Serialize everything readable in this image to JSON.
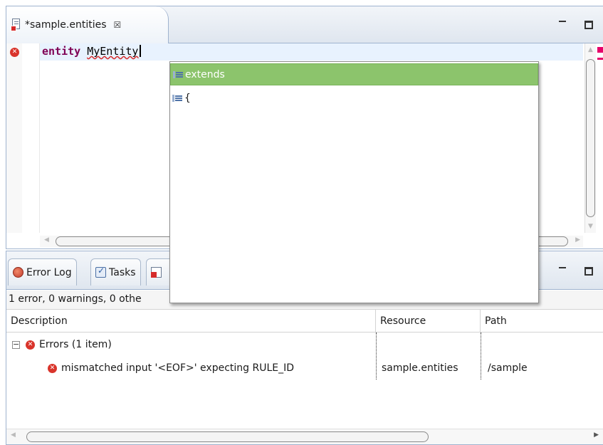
{
  "editor": {
    "tab_title": "*sample.entities",
    "tab_close_glyph": "☒",
    "code": {
      "keyword": "entity",
      "identifier": "MyEntity"
    },
    "error_marker_glyph": "✕"
  },
  "content_assist": {
    "items": [
      {
        "label": "extends",
        "selected": true
      },
      {
        "label": "{",
        "selected": false
      }
    ]
  },
  "bottom_view": {
    "tabs": [
      {
        "label": "Error Log"
      },
      {
        "label": "Tasks"
      },
      {
        "label": ""
      }
    ],
    "summary": "1 error, 0 warnings, 0 othe",
    "columns": [
      "Description",
      "Resource",
      "Path"
    ],
    "group": {
      "toggle": "−",
      "label": "Errors (1 item)"
    },
    "rows": [
      {
        "description": "mismatched input '<EOF>' expecting RULE_ID",
        "resource": "sample.entities",
        "path": "/sample"
      }
    ]
  },
  "colors": {
    "selection": "#8cc46c",
    "keyword": "#7f0055",
    "error": "#d9342b",
    "overview_marker": "#e6006a"
  }
}
